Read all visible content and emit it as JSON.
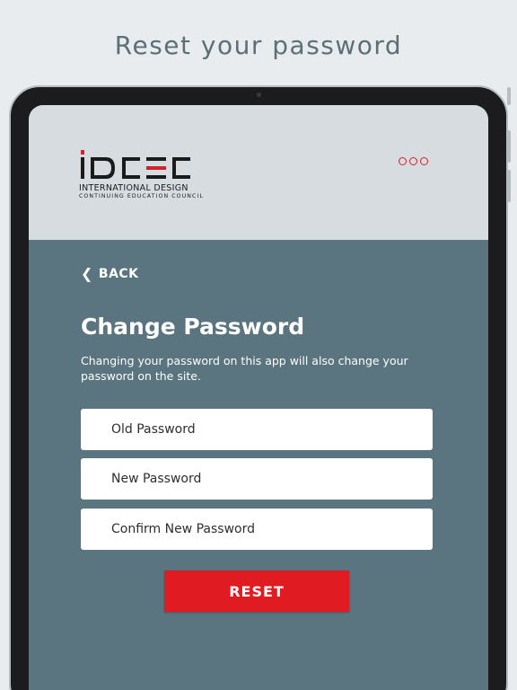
{
  "banner": {
    "headline": "Reset your password"
  },
  "app": {
    "logo": {
      "wordmark": "IDCEC",
      "line1": "INTERNATIONAL DESIGN",
      "line2": "CONTINUING EDUCATION COUNCIL"
    },
    "menu_icon": "more-dots-icon",
    "back_label": "BACK",
    "title": "Change Password",
    "description": "Changing your password on this app will also change your password on the site.",
    "fields": {
      "old_placeholder": "Old Password",
      "new_placeholder": "New Password",
      "confirm_placeholder": "Confirm New Password"
    },
    "reset_label": "RESET"
  },
  "colors": {
    "accent": "#e11b22",
    "content_bg": "#5a7580",
    "header_bg": "#d6dce0",
    "page_bg": "#e9ecee"
  }
}
